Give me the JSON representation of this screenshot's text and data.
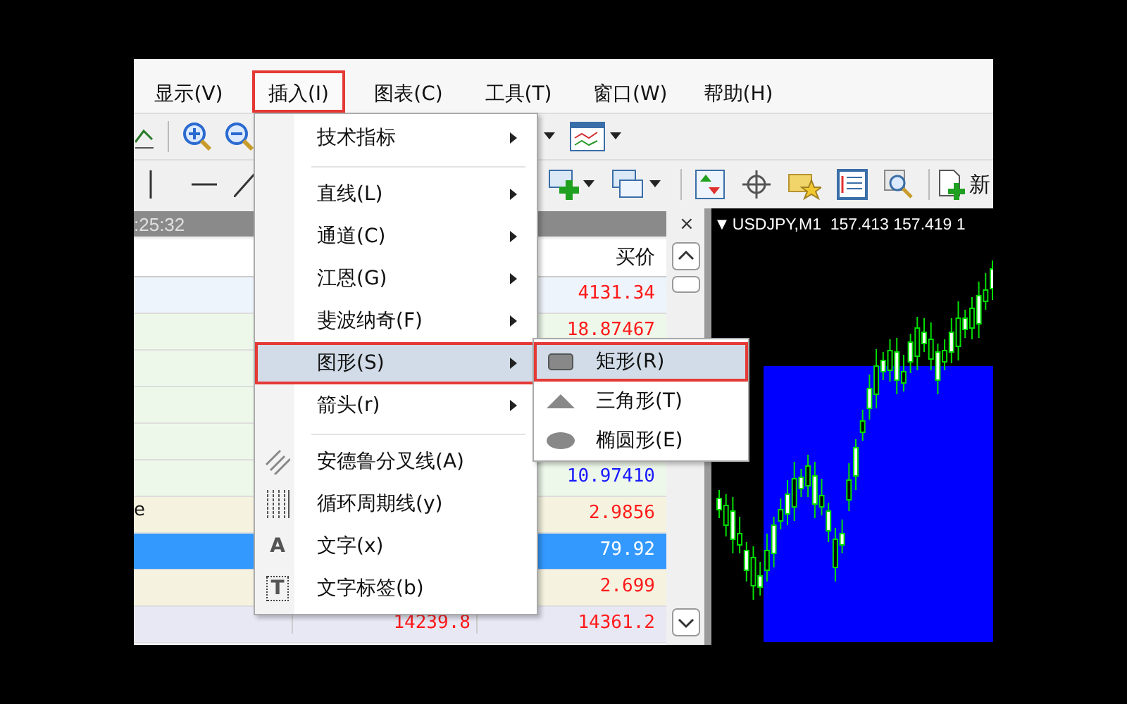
{
  "menu_bar": [
    {
      "label": "显示(V)",
      "selected": false
    },
    {
      "label": "插入(I)",
      "selected": true
    },
    {
      "label": "图表(C)",
      "selected": false
    },
    {
      "label": "工具(T)",
      "selected": false
    },
    {
      "label": "窗口(W)",
      "selected": false
    },
    {
      "label": "帮助(H)",
      "selected": false
    }
  ],
  "toolbar": {
    "new_label": "新"
  },
  "market_watch": {
    "time": ":25:32",
    "close": "×",
    "column_header": "买价",
    "rows": [
      {
        "color": "#eef4fb",
        "selected": false,
        "bid": {
          "text": "4131.34",
          "color": "#ff1a1a"
        }
      },
      {
        "color": "#eef8ea",
        "selected": false,
        "bid": {
          "text": "18.87467",
          "color": "#ff1a1a"
        }
      },
      {
        "color": "#eef8ea",
        "selected": false
      },
      {
        "color": "#eef8ea",
        "selected": false
      },
      {
        "color": "#eef8ea",
        "selected": false
      },
      {
        "color": "#eef8ea",
        "selected": false,
        "bid": {
          "text": "10.97410",
          "color": "#1a1aff"
        }
      },
      {
        "color": "#f5f3df",
        "selected": false,
        "symbol": "e",
        "bid": {
          "text": "2.9856",
          "color": "#ff1a1a"
        }
      },
      {
        "selected": true,
        "bid": {
          "text": "79.92"
        }
      },
      {
        "color": "#f5f3df",
        "selected": false,
        "bid": {
          "text": "2.699",
          "color": "#ff1a1a"
        }
      },
      {
        "color": "#e8e8f5",
        "selected": false,
        "column_2": {
          "text": "14239.8",
          "color": "#ff1a1a"
        },
        "bid": {
          "text": "14361.2",
          "color": "#ff1a1a"
        }
      }
    ]
  },
  "chart": {
    "marker": "▼",
    "title": "USDJPY,M1  157.413 157.419 1"
  },
  "insert_menu": {
    "items": [
      {
        "kind": "plain",
        "label": "技术指标",
        "submenu": true,
        "selected": false
      },
      {
        "kind": "separator"
      },
      {
        "kind": "plain",
        "label": "直线(L)",
        "submenu": true,
        "selected": false
      },
      {
        "kind": "plain",
        "label": "通道(C)",
        "submenu": true,
        "selected": false
      },
      {
        "kind": "plain",
        "label": "江恩(G)",
        "submenu": true,
        "selected": false
      },
      {
        "kind": "plain",
        "label": "斐波纳奇(F)",
        "submenu": true,
        "selected": false
      },
      {
        "kind": "plain",
        "label": "图形(S)",
        "submenu": true,
        "selected": true
      },
      {
        "kind": "plain",
        "label": "箭头(r)",
        "submenu": true,
        "selected": false
      },
      {
        "kind": "separator"
      },
      {
        "kind": "pitchfork",
        "label": "安德鲁分叉线(A)",
        "submenu": false,
        "selected": false
      },
      {
        "kind": "cycles",
        "label": "循环周期线(y)",
        "submenu": false,
        "selected": false
      },
      {
        "kind": "glyph",
        "glyph": "A",
        "label": "文字(x)",
        "submenu": false,
        "selected": false
      },
      {
        "kind": "boxed",
        "glyph": "T",
        "label": "文字标签(b)",
        "submenu": false,
        "selected": false
      }
    ]
  },
  "shapes_submenu": {
    "items": [
      {
        "kind": "rectangle",
        "label": "矩形(R)",
        "selected": true
      },
      {
        "kind": "triangle",
        "label": "三角形(T)",
        "selected": false
      },
      {
        "kind": "ellipse",
        "label": "椭圆形(E)",
        "selected": false
      }
    ]
  }
}
